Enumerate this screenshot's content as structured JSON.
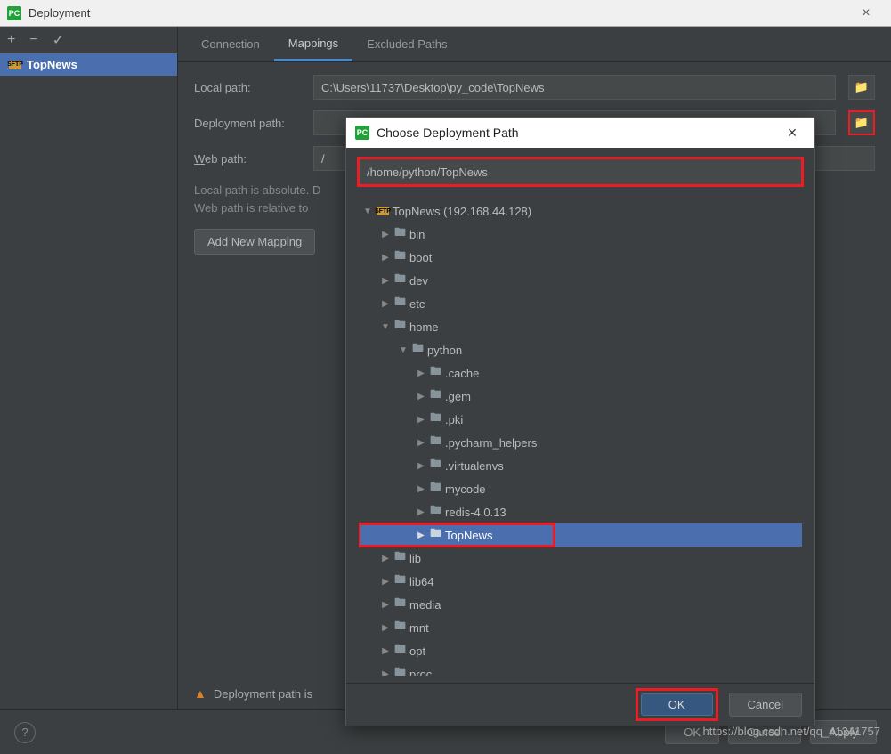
{
  "window": {
    "title": "Deployment"
  },
  "sidebar": {
    "server": "TopNews"
  },
  "tabs": {
    "connection": "Connection",
    "mappings": "Mappings",
    "excluded": "Excluded Paths"
  },
  "form": {
    "local_label": "Local path:",
    "local_value": "C:\\Users\\11737\\Desktop\\py_code\\TopNews",
    "deploy_label": "Deployment path:",
    "web_label": "Web path:",
    "web_value": "/",
    "hint_line1": "Local path is absolute. D",
    "hint_line2": "Web path is relative to ",
    "add_mapping": "Add New Mapping",
    "warning": "Deployment path is"
  },
  "dialog": {
    "title": "Choose Deployment Path",
    "path": "/home/python/TopNews",
    "root": "TopNews (192.168.44.128)",
    "tree": {
      "bin": "bin",
      "boot": "boot",
      "dev": "dev",
      "etc": "etc",
      "home": "home",
      "python": "python",
      "cache": ".cache",
      "gem": ".gem",
      "pki": ".pki",
      "pycharm": ".pycharm_helpers",
      "venvs": ".virtualenvs",
      "mycode": "mycode",
      "redis": "redis-4.0.13",
      "topnews": "TopNews",
      "lib": "lib",
      "lib64": "lib64",
      "media": "media",
      "mnt": "mnt",
      "opt": "opt",
      "proc": "proc"
    },
    "ok": "OK",
    "cancel": "Cancel"
  },
  "footer": {
    "ok": "OK",
    "cancel": "Cancel",
    "apply": "Apply"
  },
  "watermark": "https://blog.csdn.net/qq_41341757"
}
